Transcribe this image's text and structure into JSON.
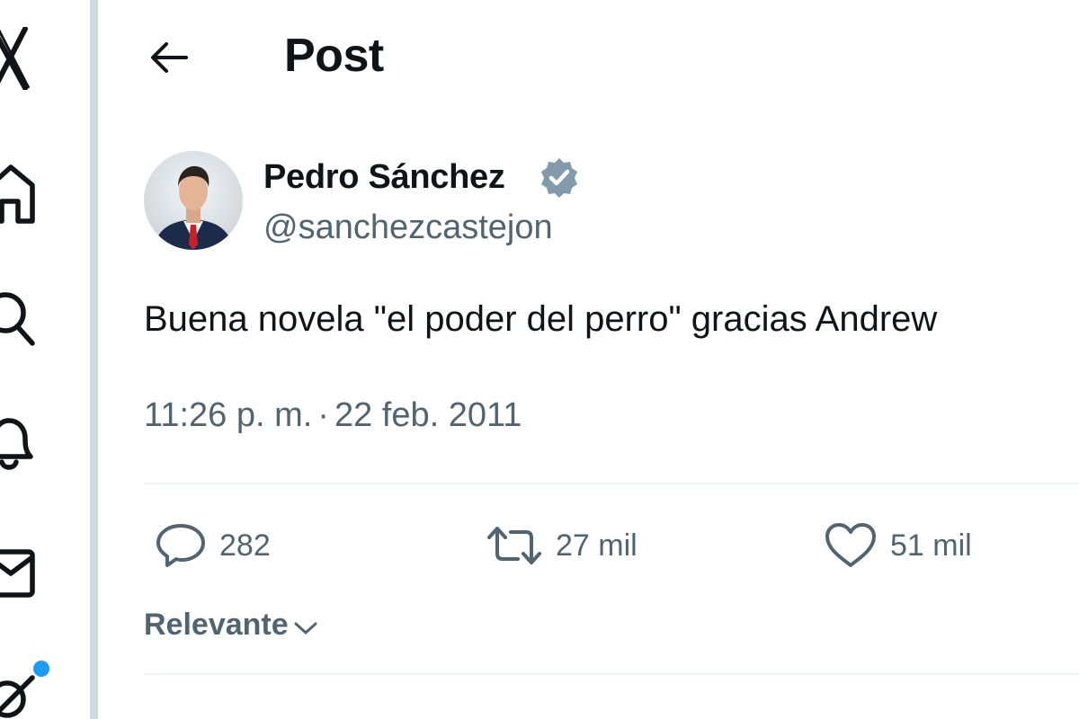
{
  "header": {
    "title": "Post",
    "back_icon": "arrow-left-icon"
  },
  "sidebar": {
    "items": [
      {
        "icon": "x-logo-icon"
      },
      {
        "icon": "home-icon"
      },
      {
        "icon": "search-icon"
      },
      {
        "icon": "bell-icon"
      },
      {
        "icon": "mail-icon"
      },
      {
        "icon": "compose-icon",
        "has_notification_dot": true
      }
    ],
    "notification_dot_color": "#1d9bf0"
  },
  "post": {
    "author": {
      "name": "Pedro Sánchez",
      "handle": "@sanchezcastejon",
      "verified": true,
      "verified_color": "#829aab"
    },
    "text": "Buena novela \"el poder del perro\" gracias Andrew",
    "time": "11:26 p. m.",
    "separator": "·",
    "date": "22 feb. 2011",
    "stats": {
      "replies": "282",
      "reposts": "27 mil",
      "likes": "51 mil"
    }
  },
  "replies_sort": {
    "label": "Relevante"
  },
  "colors": {
    "text_primary": "#0f1419",
    "text_secondary": "#536471",
    "divider": "#eff3f4",
    "rail_border": "#cfd9de"
  }
}
